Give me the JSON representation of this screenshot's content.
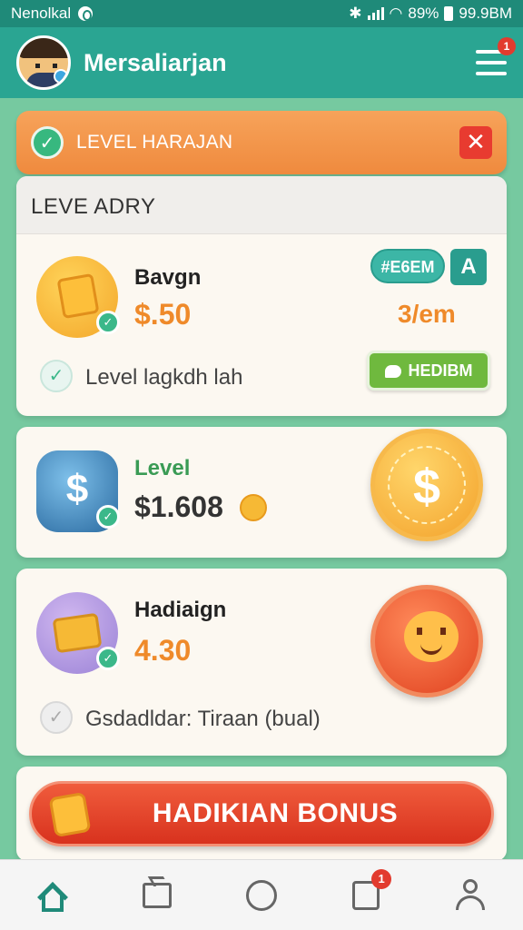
{
  "status": {
    "carrier": "Nenolkal",
    "battery": "89%",
    "time": "99.9BM"
  },
  "app": {
    "title": "Mersaliarjan",
    "menu_badge": "1"
  },
  "banner": {
    "text": "LEVEL HARAJAN"
  },
  "card1": {
    "header": "LEVE ADRY",
    "title": "Bavgn",
    "amount": "$.50",
    "pill": "#E6EM",
    "square": "A",
    "secondary": "3/em",
    "button": "HEDIBM",
    "row_text": "Level lagkdh lah"
  },
  "card2": {
    "title": "Level",
    "amount": "$1.608"
  },
  "card3": {
    "title": "Hadiaign",
    "amount": "4.30",
    "row_text": "Gsdadldar: Tiraan (bual)"
  },
  "bonus": {
    "label": "HADIKIAN BONUS"
  },
  "nav": {
    "messages_badge": "1"
  },
  "colors": {
    "primary": "#2aa592",
    "accent": "#ef8a2a",
    "danger": "#e23b2e",
    "success": "#6fb93e"
  }
}
